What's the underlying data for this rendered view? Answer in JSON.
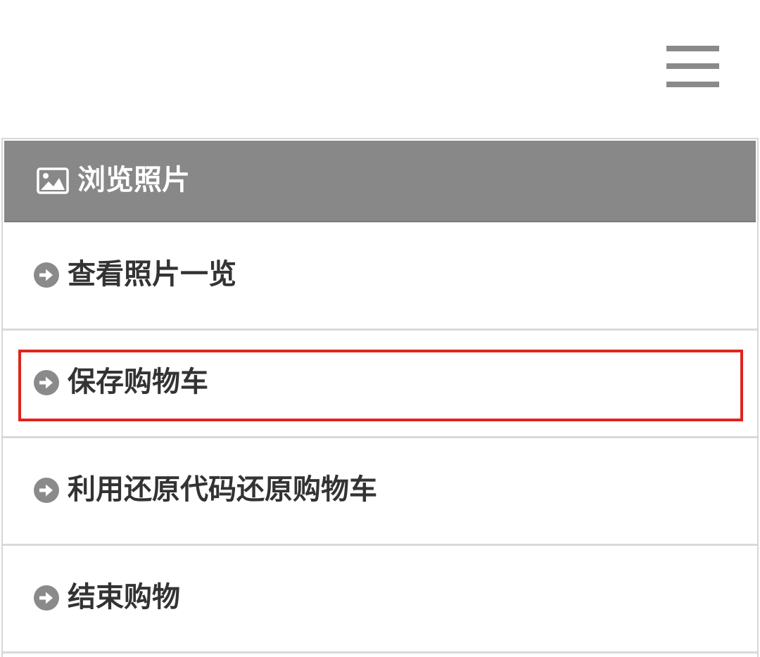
{
  "topbar": {
    "menu_icon": "hamburger-menu-icon"
  },
  "menu": {
    "header": {
      "icon": "image-icon",
      "label": "浏览照片"
    },
    "items": [
      {
        "icon": "arrow-circle-right-icon",
        "label": "查看照片一览"
      },
      {
        "icon": "arrow-circle-right-icon",
        "label": "保存购物车",
        "highlighted": true
      },
      {
        "icon": "arrow-circle-right-icon",
        "label": "利用还原代码还原购物车"
      },
      {
        "icon": "arrow-circle-right-icon",
        "label": "结束购物"
      }
    ]
  },
  "colors": {
    "header_bg": "#888888",
    "icon_gray": "#8a8a8a",
    "text": "#333333",
    "highlight": "#e0241c",
    "divider": "#d9d9d9"
  }
}
